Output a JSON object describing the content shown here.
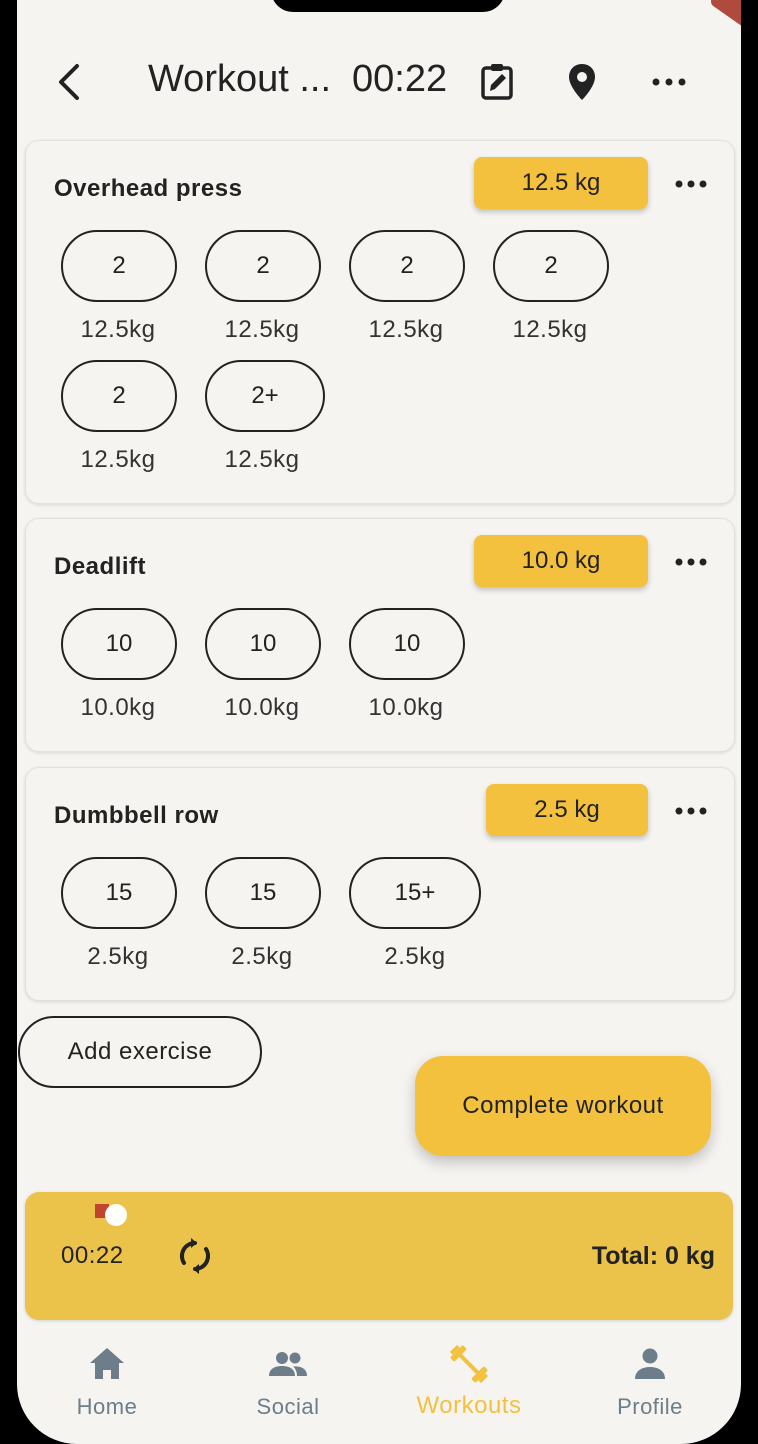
{
  "header": {
    "title": "Workout ...",
    "timer": "00:22",
    "back_icon": "back-icon",
    "notes_icon": "edit-notes-icon",
    "location_icon": "location-pin-icon",
    "more_icon": "more-horizontal-icon"
  },
  "exercises": [
    {
      "name": "Overhead press",
      "weight": "12.5 kg",
      "sets": [
        {
          "reps": "2",
          "weight": "12.5kg"
        },
        {
          "reps": "2",
          "weight": "12.5kg"
        },
        {
          "reps": "2",
          "weight": "12.5kg"
        },
        {
          "reps": "2",
          "weight": "12.5kg"
        },
        {
          "reps": "2",
          "weight": "12.5kg"
        },
        {
          "reps": "2+",
          "weight": "12.5kg"
        }
      ]
    },
    {
      "name": "Deadlift",
      "weight": "10.0 kg",
      "sets": [
        {
          "reps": "10",
          "weight": "10.0kg"
        },
        {
          "reps": "10",
          "weight": "10.0kg"
        },
        {
          "reps": "10",
          "weight": "10.0kg"
        }
      ]
    },
    {
      "name": "Dumbbell row",
      "weight": "2.5 kg",
      "sets": [
        {
          "reps": "15",
          "weight": "2.5kg"
        },
        {
          "reps": "15",
          "weight": "2.5kg"
        },
        {
          "reps": "15+",
          "weight": "2.5kg"
        }
      ]
    }
  ],
  "actions": {
    "add_exercise": "Add exercise",
    "complete_workout": "Complete workout"
  },
  "timer_bar": {
    "time": "00:22",
    "total": "Total: 0 kg"
  },
  "nav": [
    {
      "label": "Home",
      "icon": "home-icon"
    },
    {
      "label": "Social",
      "icon": "people-icon"
    },
    {
      "label": "Workouts",
      "icon": "dumbbell-icon",
      "active": true
    },
    {
      "label": "Profile",
      "icon": "person-icon"
    }
  ],
  "colors": {
    "accent": "#f4c13f",
    "timer_bar": "#ebc24a",
    "background": "#f5f4f1",
    "nav_inactive": "#6d7d89"
  }
}
